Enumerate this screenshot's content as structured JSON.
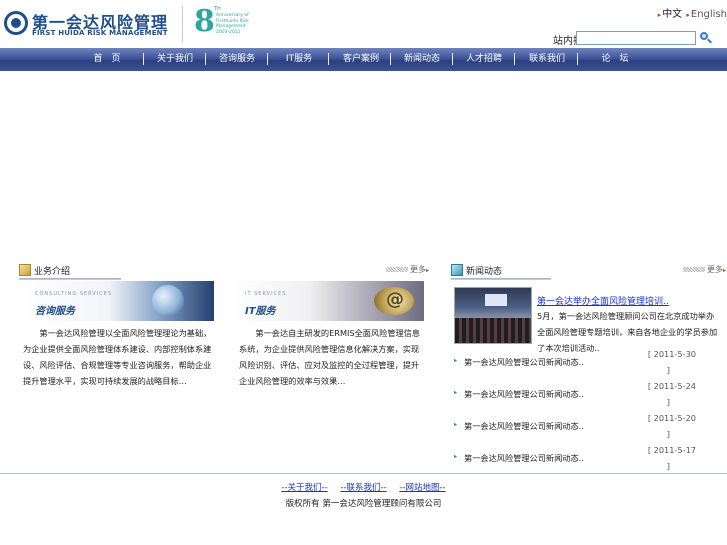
{
  "header": {
    "logo_cn": "第一会达风险管理",
    "logo_en": "FIRST HUIDA RISK MANAGEMENT",
    "anniversary_number": "8",
    "anniversary_sup": "TH",
    "anniversary_text": "Anniversary of Firsthuida Risk Management 2003-2011",
    "lang_cn": "中文",
    "lang_en": "English",
    "search_label": "站内搜索",
    "search_value": ""
  },
  "nav": {
    "items": [
      "首　页",
      "关于我们",
      "咨询服务",
      "IT服务",
      "客户案例",
      "新闻动态",
      "人才招聘",
      "联系我们",
      "论　坛"
    ]
  },
  "services": {
    "title": "业务介绍",
    "more": "更多",
    "consulting": {
      "banner_en": "CONSULTING SERVICES",
      "banner_cn": "咨询服务",
      "desc": "第一会达风险管理以全面风险管理理论为基础，为企业提供全面风险管理体系建设、内部控制体系建设、风险评估、合规管理等专业咨询服务，帮助企业提升管理水平，实现可持续发展的战略目标…"
    },
    "it": {
      "banner_en": "IT SERVICES",
      "banner_cn": "IT服务",
      "desc": "第一会达自主研发的ERMIS全面风险管理信息系统，为企业提供风险管理信息化解决方案，实现风险识别、评估、应对及监控的全过程管理，提升企业风险管理的效率与效果…"
    }
  },
  "news": {
    "title": "新闻动态",
    "more": "更多",
    "feature_title": "第一会达举办全面风险管理培训..",
    "feature_desc": "5月，第一会达风险管理顾问公司在北京成功举办全面风险管理专题培训，来自各地企业的学员参加了本次培训活动..",
    "items": [
      {
        "title": "第一会达风险管理公司新闻动态..",
        "date": "[ 2011-5-30",
        "date_close": "]"
      },
      {
        "title": "第一会达风险管理公司新闻动态..",
        "date": "[ 2011-5-24",
        "date_close": "]"
      },
      {
        "title": "第一会达风险管理公司新闻动态..",
        "date": "[ 2011-5-20",
        "date_close": "]"
      },
      {
        "title": "第一会达风险管理公司新闻动态..",
        "date": "[ 2011-5-17",
        "date_close": "]"
      }
    ]
  },
  "footer": {
    "links": [
      "--关于我们--",
      "--联系我们--",
      "--网站地图--"
    ],
    "copyright": "版权所有 第一会达风险管理顾问有限公司"
  }
}
